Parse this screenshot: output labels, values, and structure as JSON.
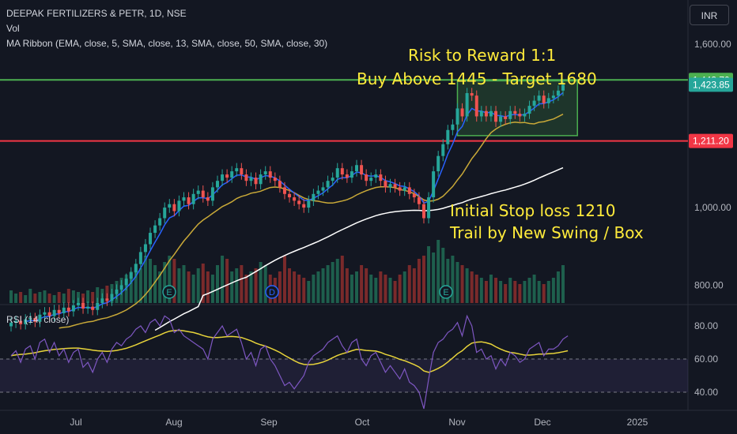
{
  "header": {
    "symbol": "DEEPAK FERTILIZERS & PETR, 1D, NSE",
    "volume_label": "Vol",
    "ma_label": "MA Ribbon (EMA, close, 5, SMA, close, 13, SMA, close, 50, SMA, close, 30)",
    "currency": "INR"
  },
  "annotations": {
    "rr": "Risk to Reward 1:1",
    "buy": "Buy Above 1445 - Target 1680",
    "stop": "Initial Stop loss  1210",
    "trail": "Trail by New Swing / Box"
  },
  "rsi_panel": {
    "label": "RSI (14, close)"
  },
  "event_markers": [
    "E",
    "D",
    "E"
  ],
  "colors": {
    "background": "#131722",
    "up": "#26a69a",
    "down": "#ef5350",
    "ema5": "#2962ff",
    "sma13": "#c9a938",
    "sma50": "#ffffff",
    "rsi": "#7e57c2",
    "rsi_ma": "#e8d43a",
    "annotation": "#ffeb3b",
    "target_line": "#4caf50",
    "stop_line": "#f23645"
  },
  "chart_data": [
    {
      "type": "candlestick",
      "title": "DEEPAK FERTILIZERS & PETR, 1D, NSE",
      "x_ticks": [
        "Jul",
        "Aug",
        "Sep",
        "Oct",
        "Nov",
        "Dec",
        "2025"
      ],
      "y_ticks": [
        "800.00",
        "1,000.00",
        "1,600.00"
      ],
      "y_ticks_values": [
        800,
        1000,
        1600
      ],
      "ylim": [
        760,
        1760
      ],
      "scale": "log",
      "price_labels": [
        {
          "text": "1,443.70",
          "value": 1443.7,
          "color": "#4caf50"
        },
        {
          "text": "1,423.85",
          "value": 1423.85,
          "color": "#26a69a"
        },
        {
          "text": "1,211.20",
          "value": 1211.2,
          "color": "#f23645"
        }
      ],
      "horizontal_lines": [
        {
          "value": 1443.7,
          "color": "#4caf50"
        },
        {
          "value": 1211.2,
          "color": "#f23645"
        }
      ],
      "box": {
        "x_start": 93,
        "x_end": 118,
        "y_low": 1230,
        "y_high": 1440
      },
      "close": [
        718,
        722,
        715,
        725,
        728,
        720,
        735,
        740,
        732,
        745,
        738,
        750,
        742,
        755,
        760,
        748,
        752,
        745,
        760,
        770,
        765,
        780,
        790,
        800,
        815,
        830,
        850,
        880,
        900,
        930,
        950,
        970,
        1000,
        1010,
        990,
        1020,
        1030,
        1010,
        1040,
        1050,
        1030,
        1020,
        1060,
        1080,
        1100,
        1090,
        1110,
        1120,
        1100,
        1080,
        1090,
        1070,
        1100,
        1110,
        1090,
        1080,
        1060,
        1040,
        1030,
        1020,
        1010,
        1000,
        1020,
        1040,
        1050,
        1060,
        1080,
        1090,
        1120,
        1100,
        1090,
        1110,
        1130,
        1100,
        1080,
        1090,
        1100,
        1080,
        1060,
        1070,
        1060,
        1050,
        1060,
        1040,
        1030,
        1010,
        970,
        1030,
        1110,
        1160,
        1200,
        1250,
        1270,
        1330,
        1300,
        1390,
        1380,
        1300,
        1320,
        1300,
        1320,
        1280,
        1300,
        1290,
        1320,
        1310,
        1300,
        1310,
        1340,
        1360,
        1380,
        1350,
        1370,
        1380,
        1400,
        1423.85
      ],
      "volume": [
        8,
        6,
        7,
        5,
        9,
        6,
        7,
        8,
        6,
        5,
        7,
        6,
        9,
        8,
        7,
        6,
        8,
        7,
        10,
        9,
        11,
        12,
        14,
        16,
        18,
        20,
        25,
        22,
        30,
        28,
        24,
        20,
        26,
        30,
        28,
        22,
        24,
        20,
        18,
        22,
        25,
        20,
        18,
        24,
        30,
        28,
        20,
        22,
        24,
        18,
        20,
        22,
        26,
        24,
        18,
        16,
        20,
        30,
        22,
        20,
        18,
        16,
        14,
        18,
        20,
        22,
        24,
        26,
        28,
        30,
        22,
        18,
        20,
        24,
        22,
        18,
        16,
        20,
        18,
        16,
        14,
        18,
        20,
        24,
        22,
        28,
        30,
        36,
        32,
        40,
        35,
        28,
        30,
        26,
        24,
        22,
        20,
        18,
        16,
        14,
        18,
        16,
        14,
        12,
        16,
        14,
        12,
        14,
        16,
        18,
        14,
        12,
        14,
        16,
        20,
        24
      ],
      "series": [
        {
          "name": "EMA 5",
          "color": "#2962ff"
        },
        {
          "name": "SMA 13",
          "color": "#c9a938"
        },
        {
          "name": "SMA 50",
          "color": "#ffffff"
        }
      ]
    },
    {
      "type": "line",
      "title": "RSI (14, close)",
      "y_ticks": [
        "40.00",
        "60.00",
        "80.00"
      ],
      "y_ticks_values": [
        40,
        60,
        80
      ],
      "ylim": [
        30,
        90
      ],
      "bands": [
        40,
        60
      ],
      "rsi": [
        62,
        65,
        58,
        66,
        68,
        60,
        70,
        72,
        64,
        70,
        62,
        66,
        58,
        64,
        66,
        55,
        58,
        52,
        60,
        64,
        58,
        66,
        70,
        68,
        72,
        74,
        78,
        80,
        76,
        82,
        84,
        80,
        86,
        84,
        76,
        78,
        74,
        72,
        70,
        68,
        66,
        60,
        72,
        76,
        80,
        74,
        76,
        78,
        70,
        60,
        64,
        56,
        66,
        68,
        60,
        56,
        50,
        44,
        46,
        42,
        46,
        50,
        58,
        62,
        64,
        66,
        70,
        72,
        74,
        68,
        64,
        70,
        72,
        60,
        56,
        62,
        64,
        58,
        52,
        56,
        52,
        48,
        54,
        46,
        44,
        40,
        30,
        48,
        64,
        70,
        72,
        76,
        78,
        82,
        74,
        86,
        80,
        64,
        66,
        60,
        62,
        54,
        60,
        56,
        64,
        62,
        58,
        60,
        66,
        68,
        70,
        62,
        66,
        66,
        68,
        72,
        74
      ],
      "rsi_ma": [
        62,
        62.5,
        62.8,
        63,
        63.4,
        63.8,
        64.5,
        65,
        65.4,
        65.8,
        66,
        66.3,
        66.5,
        66.6,
        66.6,
        66.2,
        65.8,
        65.4,
        65,
        64.8,
        64.6,
        64.8,
        65.2,
        65.8,
        66.5,
        67.5,
        68.5,
        69.8,
        71,
        72.2,
        73.4,
        74.5,
        75.8,
        76.8,
        77.2,
        77.4,
        77,
        76.5,
        76,
        75.2,
        74.2,
        73.4,
        73,
        73,
        73.2,
        73.5,
        73.6,
        73.4,
        73,
        72,
        71,
        69.6,
        68.6,
        67.8,
        66.6,
        65.4,
        64,
        62.2,
        60.6,
        59,
        57.6,
        56.8,
        56.6,
        56.8,
        57.4,
        58.2,
        59.4,
        60.8,
        62.2,
        63.2,
        64,
        65,
        65.8,
        65.6,
        65.2,
        65,
        64.8,
        64,
        62.8,
        62,
        61,
        59.8,
        59,
        57.8,
        56.6,
        55.2,
        52.8,
        52,
        53,
        54.4,
        56,
        58.2,
        60.6,
        63.2,
        65,
        67.6,
        69.6,
        70.2,
        70.4,
        69.8,
        69,
        67.4,
        66,
        64.8,
        64,
        63.6,
        63,
        62.4,
        62.4,
        62.6,
        63,
        63,
        63.2,
        63.4,
        63.8,
        64.4,
        65
      ]
    }
  ]
}
